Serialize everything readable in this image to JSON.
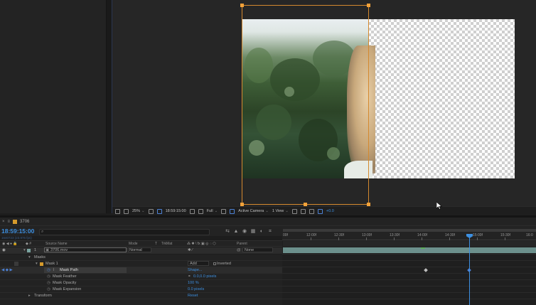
{
  "viewer": {
    "toolbar": {
      "zoom": "25%",
      "timecode": "18:59:15:00",
      "resolution": "Full",
      "camera": "Active Camera",
      "views": "1 View",
      "exposure": "+0.0"
    }
  },
  "timeline": {
    "tab_name": "3706",
    "timecode": "18:59:15:00",
    "frame_sub": "1640723 (23.976 fps)",
    "columns": {
      "source_name": "Source Name",
      "mode": "Mode",
      "t": "T",
      "trkmat": "TrkMat",
      "parent": "Parent"
    },
    "layer": {
      "index": "1",
      "name": "3706.mov",
      "mode": "Normal",
      "parent": "None"
    },
    "masks_label": "Masks",
    "mask": {
      "name": "Mask 1",
      "mode": "Add",
      "inverted": "Inverted"
    },
    "properties": [
      {
        "label": "Mask Path",
        "value": "Shape..."
      },
      {
        "label": "Mask Feather",
        "value": "0.0,0.0 pixels"
      },
      {
        "label": "Mask Opacity",
        "value": "100 %"
      },
      {
        "label": "Mask Expansion",
        "value": "0.0 pixels"
      }
    ],
    "transform": {
      "label": "Transform",
      "value": "Reset"
    },
    "ruler": [
      "00f",
      "12:00f",
      "12:30f",
      "13:00f",
      "13:30f",
      "14:00f",
      "14:30f",
      "15:00f",
      "15:30f",
      "16:0"
    ]
  },
  "colors": {
    "accent": "#3d8fe0",
    "layer_handle": "#f2a23a",
    "layer_bar": "#7aa4a0",
    "label_swatch": "#d59a2c"
  }
}
